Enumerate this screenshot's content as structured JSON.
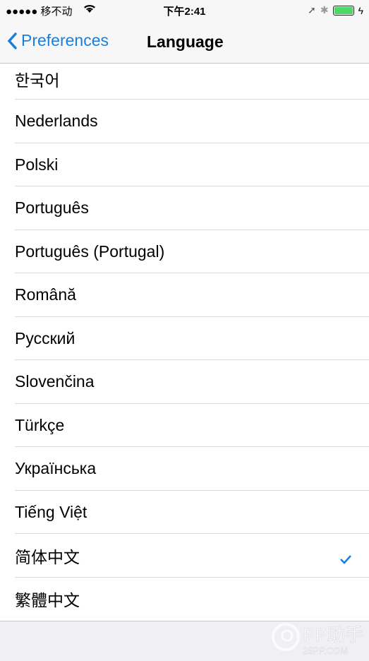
{
  "status_bar": {
    "carrier": "●●●●● 移不动",
    "time": "下午2:41"
  },
  "nav": {
    "back_label": "Preferences",
    "title": "Language"
  },
  "languages": [
    {
      "label": "한국어",
      "selected": false
    },
    {
      "label": "Nederlands",
      "selected": false
    },
    {
      "label": "Polski",
      "selected": false
    },
    {
      "label": "Português",
      "selected": false
    },
    {
      "label": "Português (Portugal)",
      "selected": false
    },
    {
      "label": "Română",
      "selected": false
    },
    {
      "label": "Русский",
      "selected": false
    },
    {
      "label": "Slovenčina",
      "selected": false
    },
    {
      "label": "Türkçe",
      "selected": false
    },
    {
      "label": "Українська",
      "selected": false
    },
    {
      "label": "Tiếng Việt",
      "selected": false
    },
    {
      "label": "简体中文",
      "selected": true
    },
    {
      "label": "繁體中文",
      "selected": false
    }
  ],
  "watermark": {
    "brand": "PP助手",
    "site": "25PP.COM"
  },
  "colors": {
    "accent": "#1a7fdc",
    "battery": "#4cd964"
  }
}
